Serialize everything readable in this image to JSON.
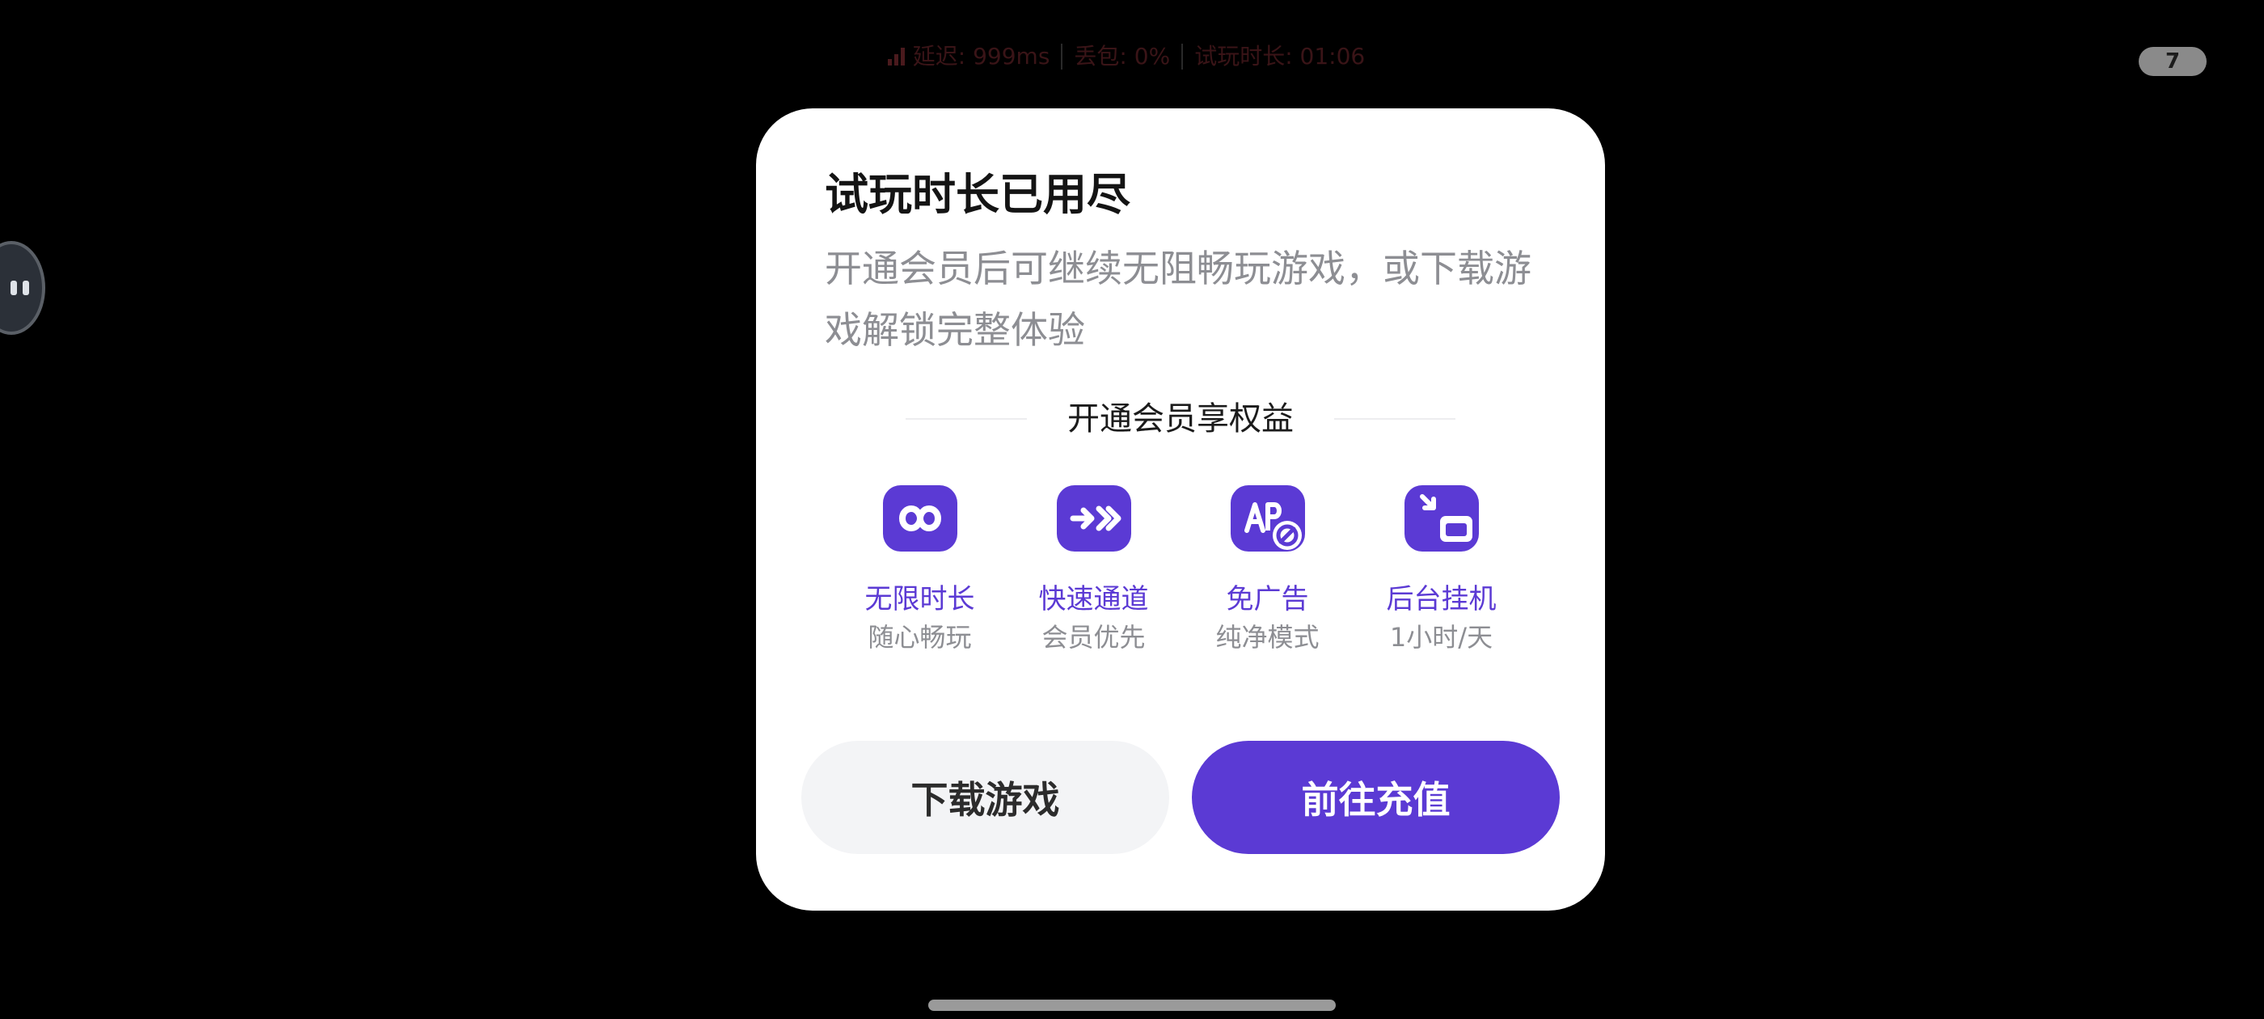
{
  "status_bar": {
    "latency": "延迟: 999ms",
    "packet_loss": "丢包: 0%",
    "trial_time": "试玩时长: 01:06",
    "signal_icon": "signal-bars-icon"
  },
  "corner_badge": {
    "value": "7"
  },
  "float_ball": {
    "icon": "assistant-float-icon"
  },
  "dialog": {
    "title": "试玩时长已用尽",
    "description": "开通会员后可继续无阻畅玩游戏，或下载游戏解锁完整体验",
    "benefits_heading": "开通会员享权益",
    "benefits": [
      {
        "icon": "infinity-icon",
        "label": "无限时长",
        "sub": "随心畅玩"
      },
      {
        "icon": "fast-forward-icon",
        "label": "快速通道",
        "sub": "会员优先"
      },
      {
        "icon": "no-ads-icon",
        "label": "免广告",
        "sub": "纯净模式"
      },
      {
        "icon": "background-mode-icon",
        "label": "后台挂机",
        "sub": "1小时/天"
      }
    ],
    "download_label": "下载游戏",
    "recharge_label": "前往充值"
  },
  "colors": {
    "accent": "#5b3ad4",
    "background": "#000000",
    "dialog_bg": "#ffffff",
    "secondary_text": "#8d8e93",
    "download_btn_bg": "#f3f4f6"
  }
}
